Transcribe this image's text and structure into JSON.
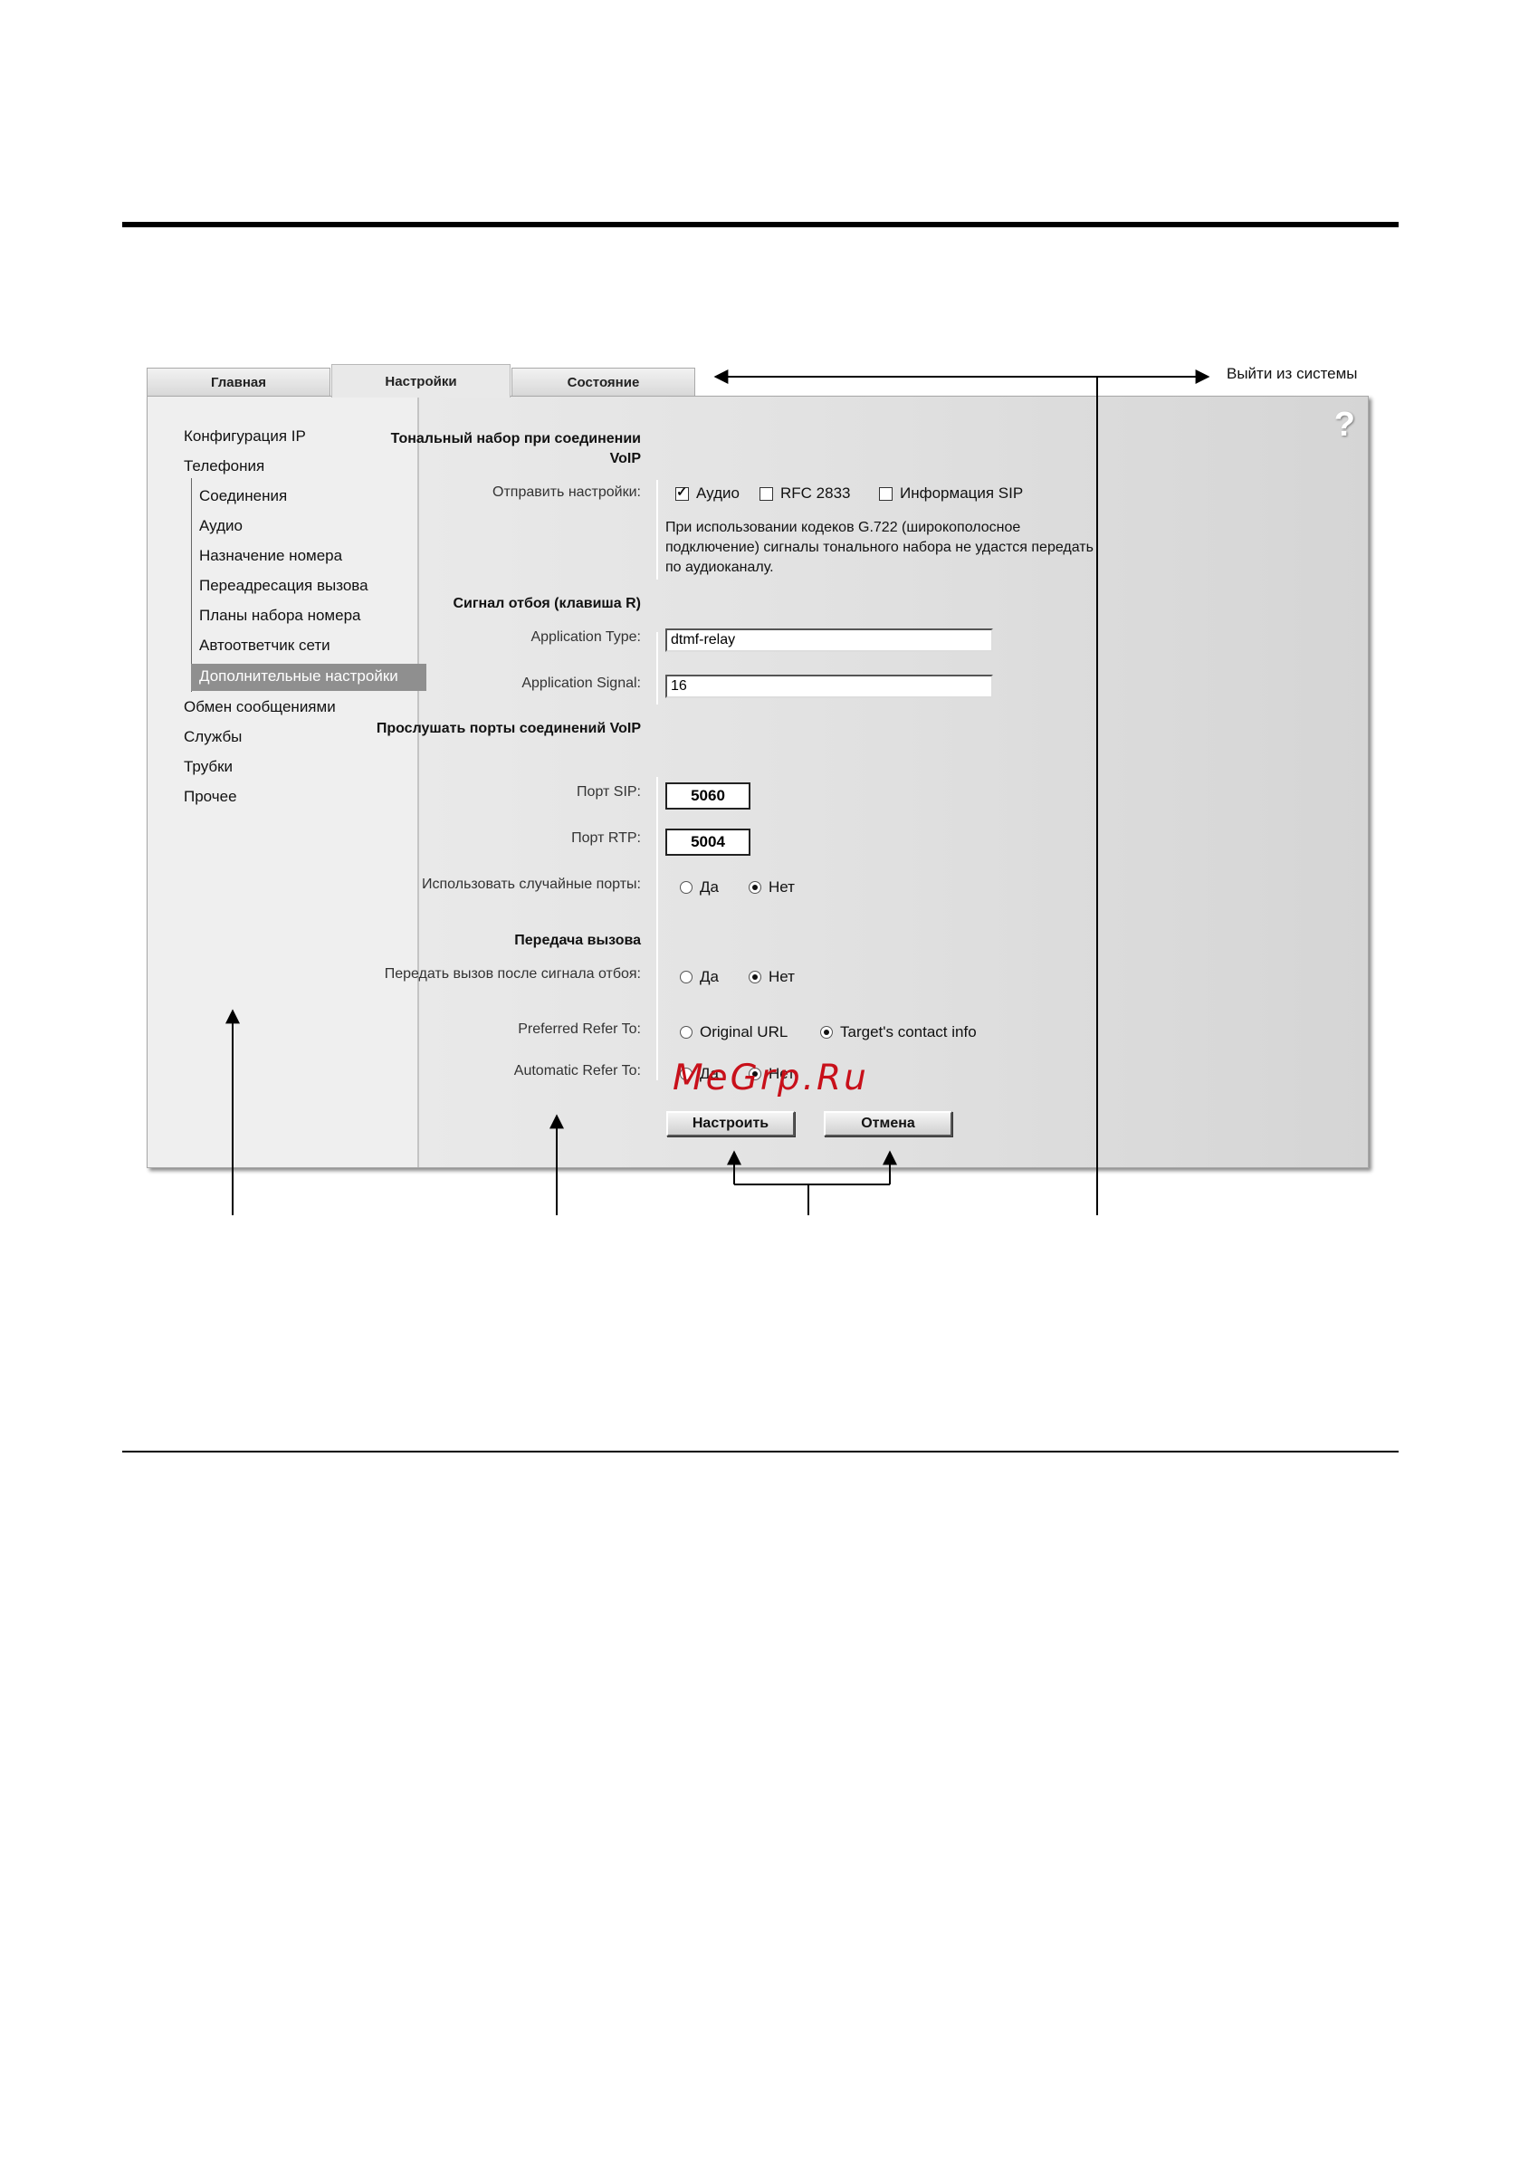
{
  "tabs": [
    {
      "label": "Главная"
    },
    {
      "label": "Настройки"
    },
    {
      "label": "Состояние"
    }
  ],
  "logout": "Выйти из системы",
  "help": "?",
  "sidebar": {
    "items": [
      {
        "label": "Конфигурация IP"
      },
      {
        "label": "Телефония"
      },
      {
        "label": "Соединения"
      },
      {
        "label": "Аудио"
      },
      {
        "label": "Назначение номера"
      },
      {
        "label": "Переадресация вызова"
      },
      {
        "label": "Планы набора номера"
      },
      {
        "label": "Автоответчик сети"
      },
      {
        "label": "Дополнительные настройки"
      },
      {
        "label": "Обмен сообщениями"
      },
      {
        "label": "Службы"
      },
      {
        "label": "Трубки"
      },
      {
        "label": "Прочее"
      }
    ]
  },
  "form": {
    "dtmf_section": "Тональный набор при соединении VoIP",
    "send_settings_label": "Отправить настройки:",
    "send_options": [
      {
        "label": "Аудио",
        "checked": true
      },
      {
        "label": "RFC 2833",
        "checked": false
      },
      {
        "label": "Информация SIP",
        "checked": false
      }
    ],
    "note": "При использовании кодеков G.722 (широкополосное подключение) сигналы тонального набора не удастся передать по аудиоканалу.",
    "hook_section": "Сигнал отбоя (клавиша R)",
    "app_type_label": "Application Type:",
    "app_type_value": "dtmf-relay",
    "app_signal_label": "Application Signal:",
    "app_signal_value": "16",
    "ports_section": "Прослушать порты соединений VoIP",
    "sip_port_label": "Порт SIP:",
    "sip_port_value": "5060",
    "rtp_port_label": "Порт RTP:",
    "rtp_port_value": "5004",
    "random_ports_label": "Использовать случайные порты:",
    "yes": "Да",
    "no": "Нет",
    "transfer_section": "Передача вызова",
    "transfer_after_hook_label": "Передать вызов после сигнала отбоя:",
    "preferred_refer_label": "Preferred Refer To:",
    "preferred_refer_options": [
      {
        "label": "Original URL",
        "selected": false
      },
      {
        "label": "Target's contact info",
        "selected": true
      }
    ],
    "automatic_refer_label": "Automatic Refer To:",
    "apply_button": "Настроить",
    "cancel_button": "Отмена"
  },
  "watermark": "MeGrp.Ru"
}
